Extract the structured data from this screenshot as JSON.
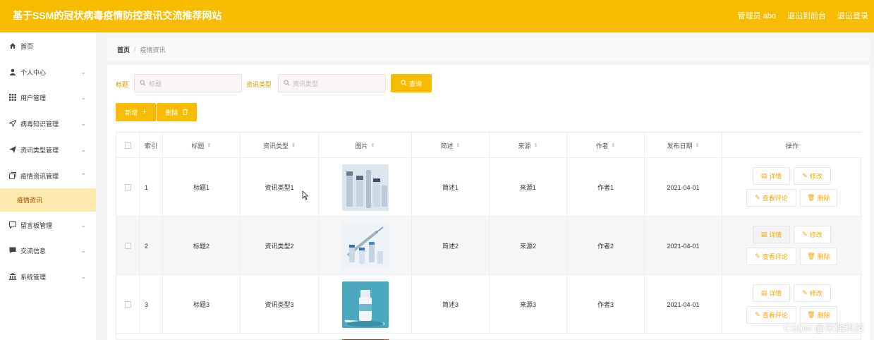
{
  "header": {
    "title": "基于SSM的冠状病毒疫情防控资讯交流推荐网站",
    "admin": "管理员 abo",
    "to_front": "退出到前台",
    "logout": "退出登录"
  },
  "sidebar": {
    "items": [
      {
        "label": "首页",
        "icon": "home-icon",
        "chevron": false
      },
      {
        "label": "个人中心",
        "icon": "user-icon",
        "chevron": true
      },
      {
        "label": "用户管理",
        "icon": "grid-icon",
        "chevron": true
      },
      {
        "label": "病毒知识管理",
        "icon": "send-icon",
        "chevron": true
      },
      {
        "label": "资讯类型管理",
        "icon": "paper-plane-icon",
        "chevron": true
      },
      {
        "label": "疫情资讯管理",
        "icon": "copy-icon",
        "chevron": true
      },
      {
        "label": "留言板管理",
        "icon": "message-icon",
        "chevron": true
      },
      {
        "label": "交流信息",
        "icon": "chat-icon",
        "chevron": true
      },
      {
        "label": "系统管理",
        "icon": "bank-icon",
        "chevron": true
      }
    ],
    "active_sub": "疫情资讯"
  },
  "breadcrumb": {
    "home": "首页",
    "sep": "/",
    "current": "疫情资讯"
  },
  "filters": {
    "title_label": "标题",
    "title_placeholder": "标题",
    "type_label": "资讯类型",
    "type_placeholder": "资讯类型",
    "search_button": "查询"
  },
  "actions": {
    "add": "新增",
    "delete": "删除"
  },
  "table": {
    "columns": [
      "索引",
      "标题",
      "资讯类型",
      "图片",
      "简述",
      "来源",
      "作者",
      "发布日期",
      "操作"
    ],
    "rows": [
      {
        "index": "1",
        "title": "标题1",
        "type": "资讯类型1",
        "summary": "简述1",
        "source": "来源1",
        "author": "作者1",
        "date": "2021-04-01"
      },
      {
        "index": "2",
        "title": "标题2",
        "type": "资讯类型2",
        "summary": "简述2",
        "source": "来源2",
        "author": "作者2",
        "date": "2021-04-01"
      },
      {
        "index": "3",
        "title": "标题3",
        "type": "资讯类型3",
        "summary": "简述3",
        "source": "来源3",
        "author": "作者3",
        "date": "2021-04-01"
      }
    ],
    "row_actions": {
      "detail": "详情",
      "edit": "修改",
      "comments": "查看评论",
      "delete": "删除"
    }
  },
  "watermark": "CSDN @米偶科技",
  "colors": {
    "accent": "#f7bc00",
    "active_bg": "#fce9ae",
    "label": "#d49a00"
  }
}
